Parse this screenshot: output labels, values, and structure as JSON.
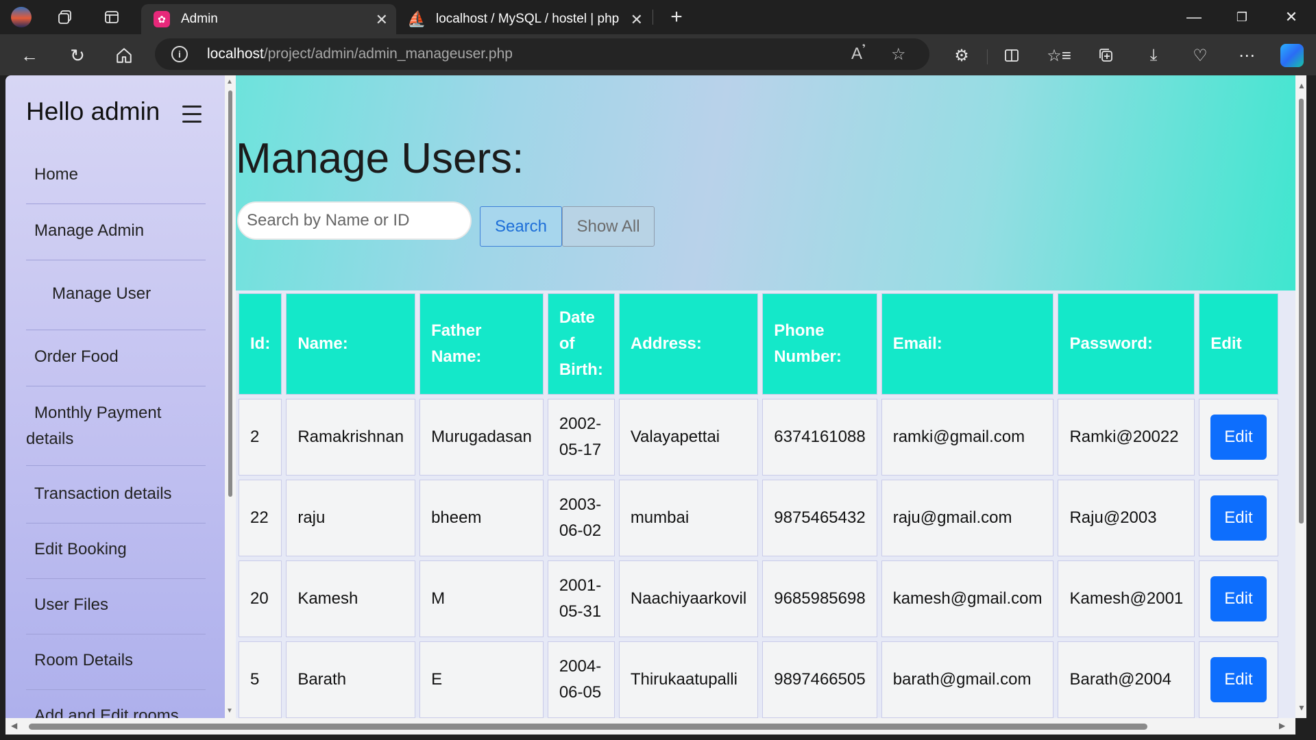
{
  "browser": {
    "tabs": [
      {
        "title": "Admin",
        "active": true,
        "icon": "xampp-icon",
        "icon_color": "#e7287a"
      },
      {
        "title": "localhost / MySQL / hostel | php",
        "active": false,
        "icon": "phpmyadmin-icon",
        "icon_color": "#f29a1f"
      }
    ],
    "url_host": "localhost",
    "url_path": "/project/admin/admin_manageuser.php"
  },
  "sidebar": {
    "title": "Hello admin",
    "items": [
      {
        "label": "Home"
      },
      {
        "label": "Manage Admin"
      },
      {
        "label": "Manage User"
      },
      {
        "label": "Order Food"
      },
      {
        "label": "Monthly Payment details"
      },
      {
        "label": "Transaction details"
      },
      {
        "label": "Edit Booking"
      },
      {
        "label": "User Files"
      },
      {
        "label": "Room Details"
      },
      {
        "label": "Add and Edit rooms"
      }
    ]
  },
  "main": {
    "title": "Manage Users:",
    "search_placeholder": "Search by Name or ID",
    "search_label": "Search",
    "show_all_label": "Show All",
    "columns": [
      "Id:",
      "Name:",
      "Father Name:",
      "Date of Birth:",
      "Address:",
      "Phone Number:",
      "Email:",
      "Password:",
      "Edit"
    ],
    "rows": [
      {
        "id": "2",
        "name": "Ramakrishnan",
        "father": "Murugadasan",
        "dob": "2002-05-17",
        "address": "Valayapettai",
        "phone": "6374161088",
        "email": "ramki@gmail.com",
        "password": "Ramki@20022",
        "edit": "Edit"
      },
      {
        "id": "22",
        "name": "raju",
        "father": "bheem",
        "dob": "2003-06-02",
        "address": "mumbai",
        "phone": "9875465432",
        "email": "raju@gmail.com",
        "password": "Raju@2003",
        "edit": "Edit"
      },
      {
        "id": "20",
        "name": "Kamesh",
        "father": "M",
        "dob": "2001-05-31",
        "address": "Naachiyaarkovil",
        "phone": "9685985698",
        "email": "kamesh@gmail.com",
        "password": "Kamesh@2001",
        "edit": "Edit"
      },
      {
        "id": "5",
        "name": "Barath",
        "father": "E",
        "dob": "2004-06-05",
        "address": "Thirukaatupalli",
        "phone": "9897466505",
        "email": "barath@gmail.com",
        "password": "Barath@2004",
        "edit": "Edit"
      }
    ]
  },
  "colors": {
    "header_teal": "#14e8c9",
    "edit_blue": "#0d6efd",
    "sidebar_lavender": "#c4c3f1"
  }
}
